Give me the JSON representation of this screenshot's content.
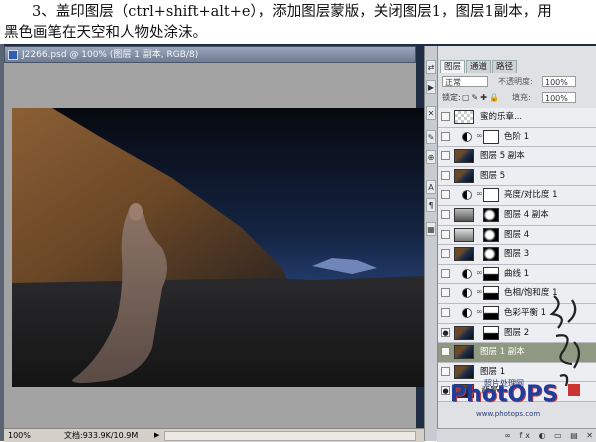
{
  "instruction": {
    "line1": "3、盖印图层（ctrl+shift+alt+e），添加图层蒙版，关闭图层1，图层1副本，用",
    "line2": "黑色画笔在天空和人物处涂沫。"
  },
  "document": {
    "title": "J2266.psd @ 100% (图层 1 副本, RGB/8)"
  },
  "status": {
    "zoom": "100%",
    "doc_size": "文档:933.9K/10.9M"
  },
  "layers_panel": {
    "tabs": [
      "图层",
      "通道",
      "路径"
    ],
    "blend_mode": "正常",
    "opacity_label": "不透明度:",
    "opacity_value": "100%",
    "lock_label": "锁定:",
    "fill_label": "填充:",
    "fill_value": "100%",
    "layers": [
      {
        "name": "蜜的乐章...",
        "kind": "text"
      },
      {
        "name": "色阶 1",
        "kind": "adjustment"
      },
      {
        "name": "图层 5 副本",
        "kind": "pixel"
      },
      {
        "name": "图层 5",
        "kind": "pixel"
      },
      {
        "name": "亮度/对比度 1",
        "kind": "adjustment"
      },
      {
        "name": "图层 4 副本",
        "kind": "masked"
      },
      {
        "name": "图层 4",
        "kind": "masked"
      },
      {
        "name": "图层 3",
        "kind": "masked"
      },
      {
        "name": "曲线 1",
        "kind": "adjustment"
      },
      {
        "name": "色相/饱和度 1",
        "kind": "adjustment"
      },
      {
        "name": "色彩平衡 1",
        "kind": "adjustment"
      },
      {
        "name": "图层 2",
        "kind": "masked"
      },
      {
        "name": "图层 1 副本",
        "kind": "pixel",
        "selected": true
      },
      {
        "name": "图层 1",
        "kind": "pixel"
      },
      {
        "name": "背景",
        "kind": "pixel"
      }
    ]
  },
  "watermark": {
    "site_label": "照片处理网",
    "logo": "PhotOPS",
    "url": "www.photops.com"
  },
  "colors": {
    "sky_dark": "#0b1020",
    "sky_blue": "#20366a",
    "mountain": "#6e4a2a",
    "selected_layer": "#8f9880"
  }
}
